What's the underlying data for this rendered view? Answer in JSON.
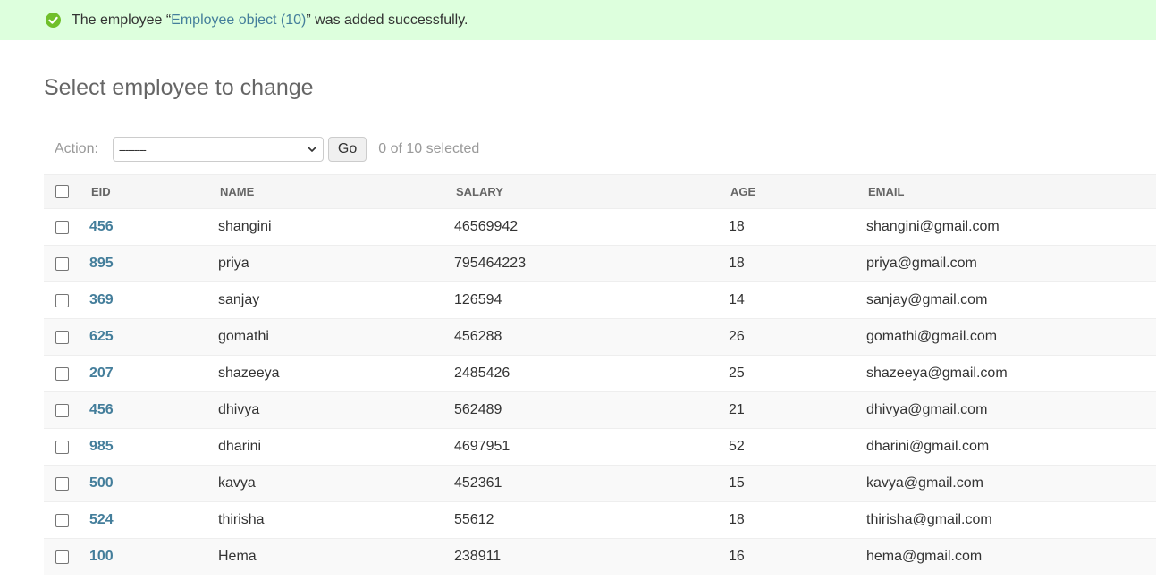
{
  "message": {
    "prefix": "The employee “",
    "link_text": "Employee object (10)",
    "suffix": "” was added successfully.",
    "icon": "check-circle-icon",
    "color": "#70bf2b"
  },
  "page_title": "Select employee to change",
  "actions": {
    "label": "Action:",
    "select_value": "---------",
    "go_label": "Go",
    "selected_text": "0 of 10 selected"
  },
  "table": {
    "headers": [
      "EID",
      "NAME",
      "SALARY",
      "AGE",
      "EMAIL"
    ],
    "rows": [
      {
        "eid": "456",
        "name": "shangini",
        "salary": "46569942",
        "age": "18",
        "email": "shangini@gmail.com"
      },
      {
        "eid": "895",
        "name": "priya",
        "salary": "795464223",
        "age": "18",
        "email": "priya@gmail.com"
      },
      {
        "eid": "369",
        "name": "sanjay",
        "salary": "126594",
        "age": "14",
        "email": "sanjay@gmail.com"
      },
      {
        "eid": "625",
        "name": "gomathi",
        "salary": "456288",
        "age": "26",
        "email": "gomathi@gmail.com"
      },
      {
        "eid": "207",
        "name": "shazeeya",
        "salary": "2485426",
        "age": "25",
        "email": "shazeeya@gmail.com"
      },
      {
        "eid": "456",
        "name": "dhivya",
        "salary": "562489",
        "age": "21",
        "email": "dhivya@gmail.com"
      },
      {
        "eid": "985",
        "name": "dharini",
        "salary": "4697951",
        "age": "52",
        "email": "dharini@gmail.com"
      },
      {
        "eid": "500",
        "name": "kavya",
        "salary": "452361",
        "age": "15",
        "email": "kavya@gmail.com"
      },
      {
        "eid": "524",
        "name": "thirisha",
        "salary": "55612",
        "age": "18",
        "email": "thirisha@gmail.com"
      },
      {
        "eid": "100",
        "name": "Hema",
        "salary": "238911",
        "age": "16",
        "email": "hema@gmail.com"
      }
    ]
  },
  "colors": {
    "link": "#447e9b",
    "success_bg": "#ddffdd"
  }
}
